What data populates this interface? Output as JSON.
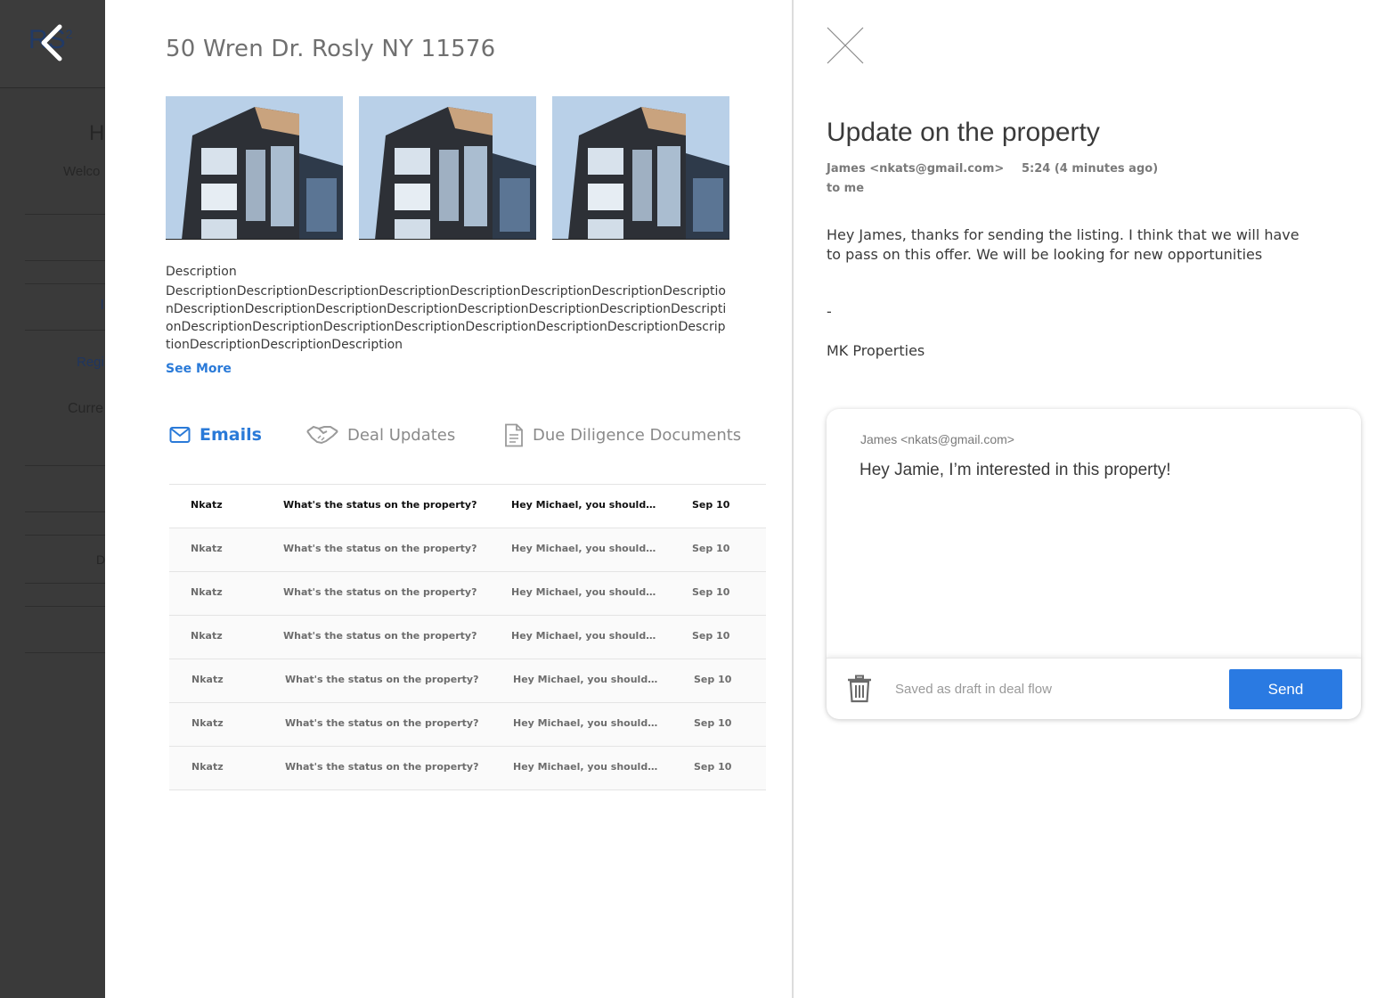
{
  "background": {
    "logo": "RS",
    "logo_sup": "2",
    "fragments": [
      "H",
      "Welco",
      "l",
      "Regi",
      "Curre",
      "D"
    ]
  },
  "property": {
    "address": "50 Wren Dr. Rosly NY 11576",
    "photos": [
      "building-photo",
      "building-photo",
      "building-photo"
    ],
    "description_label": "Description",
    "description_text": "DescriptionDescriptionDescriptionDescriptionDescriptionDescriptionDescriptionDescriptionDescriptionDescriptionDescriptionDescriptionDescriptionDescriptionDescriptionDescriptionDescriptionDescriptionDescriptionDescriptionDescriptionDescriptionDescriptionDescriptionDescriptionDescriptionDescription",
    "see_more": "See More",
    "tabs": {
      "emails": "Emails",
      "deal_updates": "Deal Updates",
      "due_diligence": "Due Diligence Documents"
    },
    "emails": [
      {
        "from": "Nkatz",
        "subject": "What's the status on the property?",
        "preview": "Hey Michael, you should…",
        "date": "Sep 10"
      },
      {
        "from": "Nkatz",
        "subject": "What's the status on the property?",
        "preview": "Hey Michael, you should…",
        "date": "Sep 10"
      },
      {
        "from": "Nkatz",
        "subject": "What's the status on the property?",
        "preview": "Hey Michael, you should…",
        "date": "Sep 10"
      },
      {
        "from": "Nkatz",
        "subject": "What's the status on the property?",
        "preview": "Hey Michael, you should…",
        "date": "Sep 10"
      },
      {
        "from": "Nkatz",
        "subject": "What's the status on the property?",
        "preview": "Hey Michael, you should…",
        "date": "Sep 10"
      },
      {
        "from": "Nkatz",
        "subject": "What's the status on the property?",
        "preview": "Hey Michael, you should…",
        "date": "Sep 10"
      },
      {
        "from": "Nkatz",
        "subject": "What's the status on the property?",
        "preview": "Hey Michael, you should…",
        "date": "Sep 10"
      }
    ]
  },
  "email": {
    "subject": "Update on the property",
    "sender": "James <nkats@gmail.com>",
    "time": "5:24 (4 minutes ago)",
    "to": "to me",
    "body": "Hey James, thanks for sending the listing. I think that we will have to pass on this offer. We will be looking for new opportunities",
    "dash": "-",
    "signature": "MK Properties"
  },
  "reply": {
    "from": "James <nkats@gmail.com>",
    "text": "Hey Jamie, I’m interested in this property!",
    "draft_status": "Saved as draft in deal flow",
    "send_label": "Send"
  },
  "colors": {
    "accent": "#2a7ad8",
    "send_button": "#2a7ae2",
    "overlay": "#3d3d3d"
  }
}
